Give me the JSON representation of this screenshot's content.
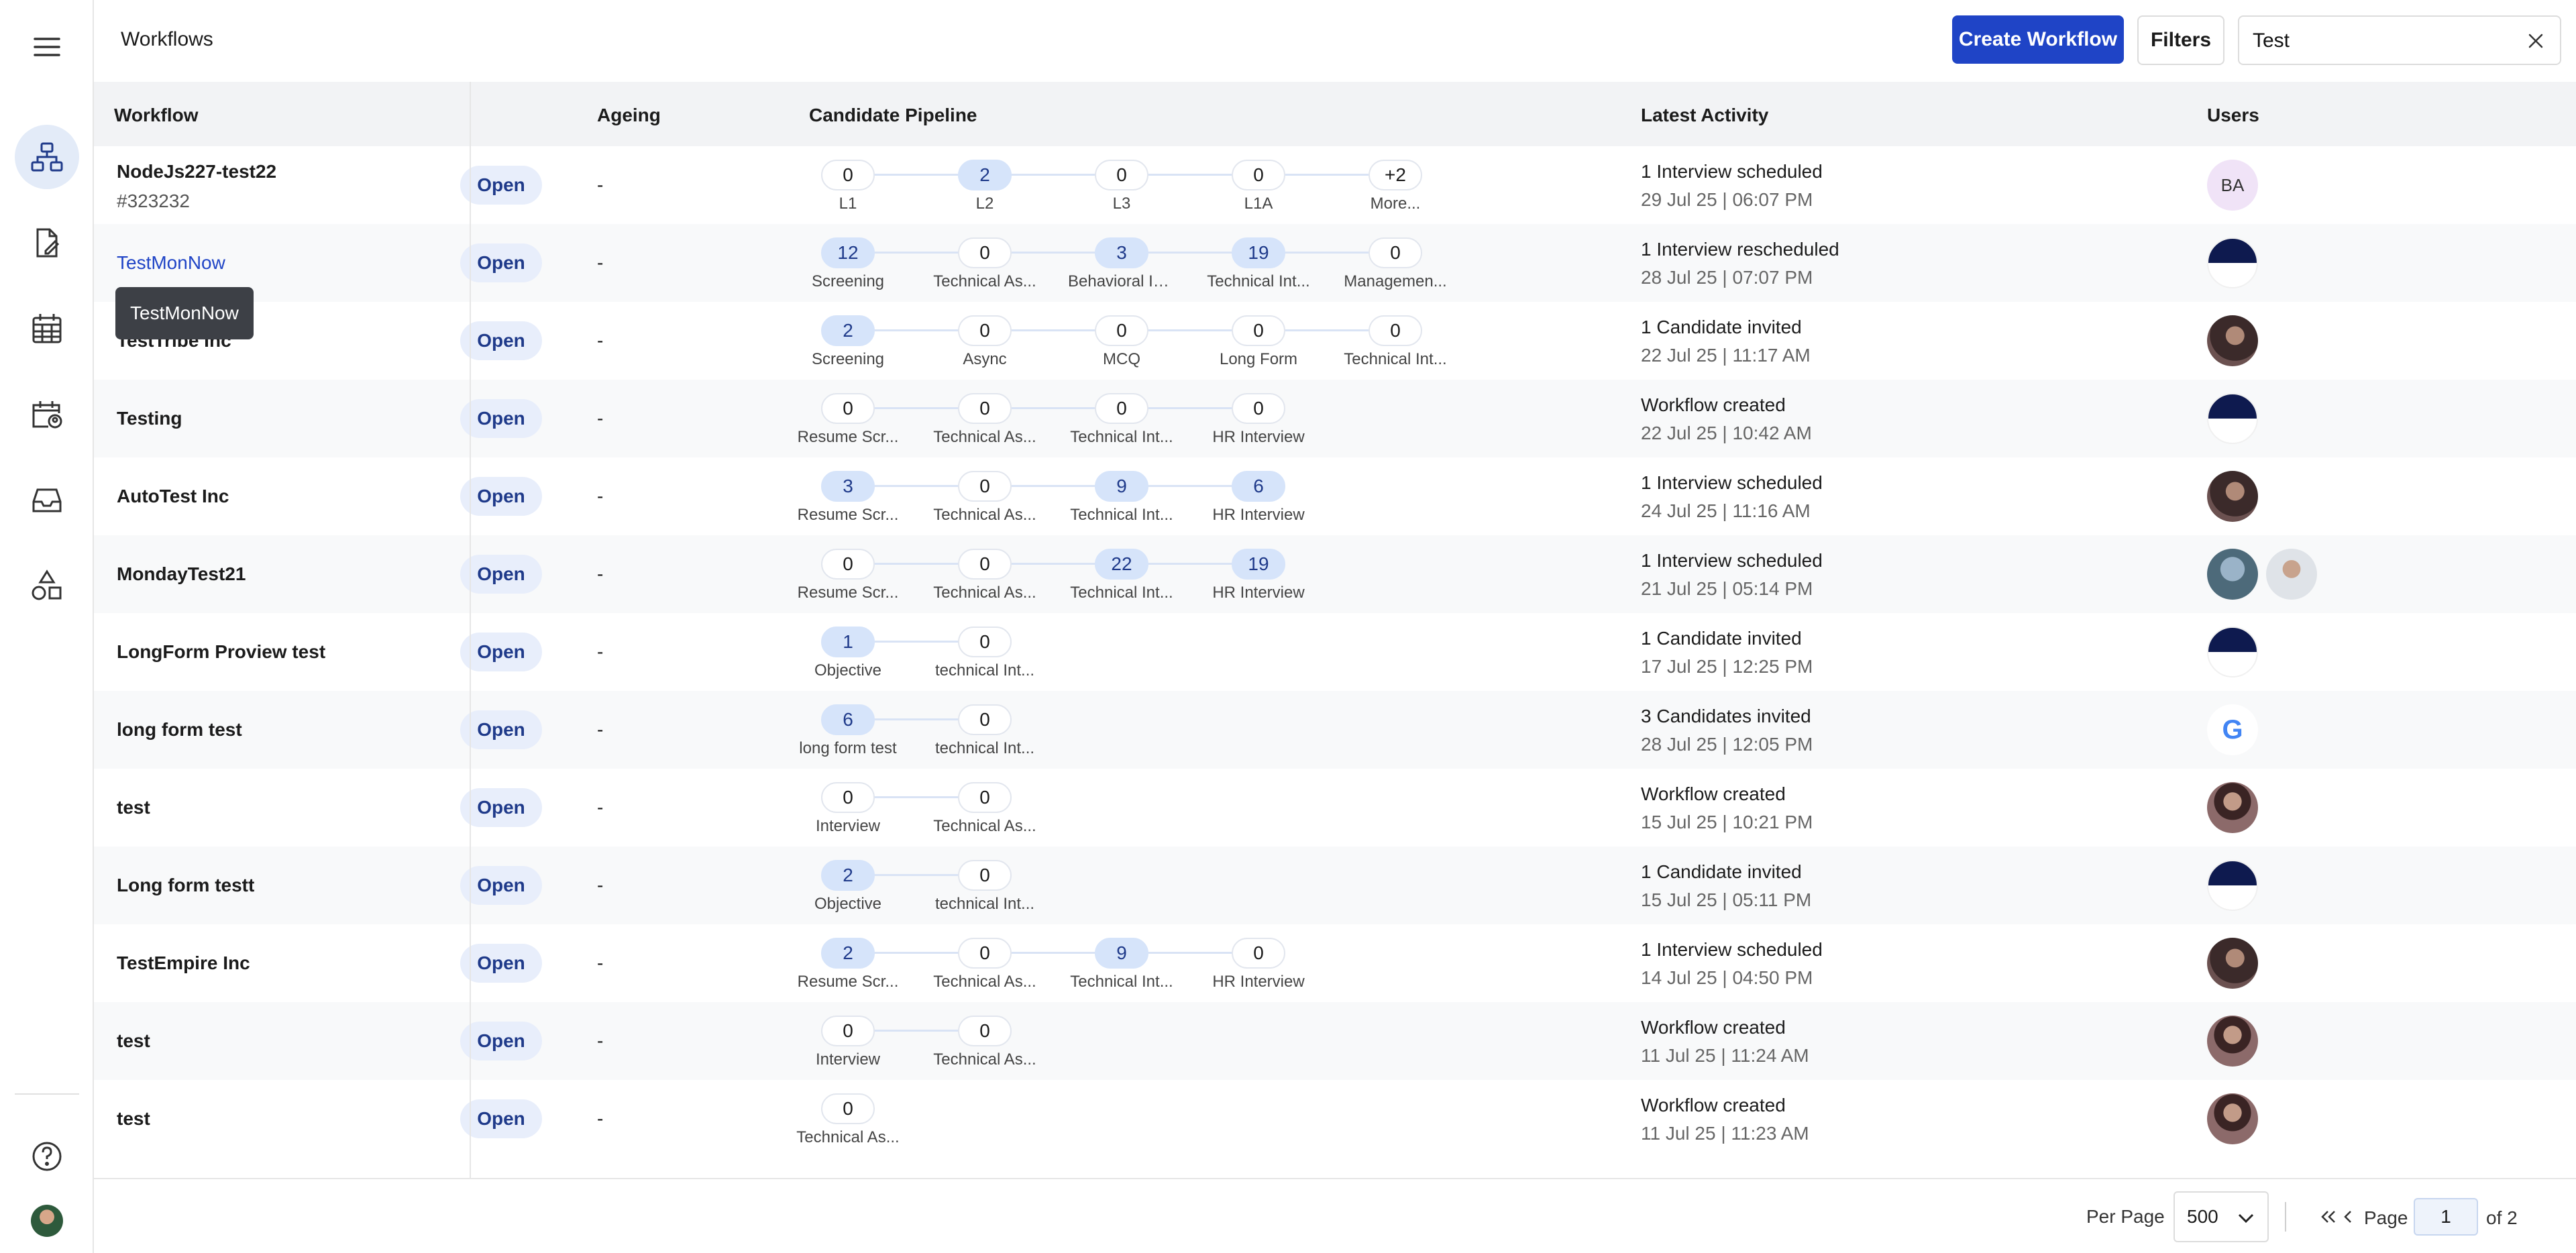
{
  "header": {
    "title": "Workflows",
    "create_label": "Create Workflow",
    "filters_label": "Filters",
    "search_value": "Test"
  },
  "columns": {
    "workflow": "Workflow",
    "ageing": "Ageing",
    "pipeline": "Candidate Pipeline",
    "activity": "Latest Activity",
    "users": "Users"
  },
  "tooltip": "TestMonNow",
  "colors": {
    "accent": "#1f44c6",
    "badge_bg": "#e8eefb",
    "stage_active": "#d6e4fa"
  },
  "rows": [
    {
      "name": "NodeJs227-test22",
      "id": "#323232",
      "status": "Open",
      "ageing": "-",
      "stages": [
        {
          "count": "0",
          "label": "L1"
        },
        {
          "count": "2",
          "label": "L2"
        },
        {
          "count": "0",
          "label": "L3"
        },
        {
          "count": "0",
          "label": "L1A"
        },
        {
          "count": "+2",
          "label": "More..."
        }
      ],
      "activity": "1 Interview scheduled",
      "time": "29 Jul 25 | 06:07 PM",
      "users": [
        "ba"
      ],
      "initials": "BA"
    },
    {
      "name": "TestMonNow",
      "status": "Open",
      "ageing": "-",
      "link": true,
      "stages": [
        {
          "count": "12",
          "label": "Screening"
        },
        {
          "count": "0",
          "label": "Technical As..."
        },
        {
          "count": "3",
          "label": "Behavioral In..."
        },
        {
          "count": "19",
          "label": "Technical Int..."
        },
        {
          "count": "0",
          "label": "Managemen..."
        }
      ],
      "activity": "1 Interview rescheduled",
      "time": "28 Jul 25 | 07:07 PM",
      "users": [
        "half"
      ]
    },
    {
      "name": "TestTribe Inc",
      "status": "Open",
      "ageing": "-",
      "stages": [
        {
          "count": "2",
          "label": "Screening"
        },
        {
          "count": "0",
          "label": "Async"
        },
        {
          "count": "0",
          "label": "MCQ"
        },
        {
          "count": "0",
          "label": "Long Form"
        },
        {
          "count": "0",
          "label": "Technical Int..."
        }
      ],
      "activity": "1 Candidate invited",
      "time": "22 Jul 25 | 11:17 AM",
      "users": [
        "photo"
      ]
    },
    {
      "name": "Testing",
      "status": "Open",
      "ageing": "-",
      "stages": [
        {
          "count": "0",
          "label": "Resume Scr..."
        },
        {
          "count": "0",
          "label": "Technical As..."
        },
        {
          "count": "0",
          "label": "Technical Int..."
        },
        {
          "count": "0",
          "label": "HR Interview"
        }
      ],
      "activity": "Workflow created",
      "time": "22 Jul 25 | 10:42 AM",
      "users": [
        "half"
      ]
    },
    {
      "name": "AutoTest Inc",
      "status": "Open",
      "ageing": "-",
      "stages": [
        {
          "count": "3",
          "label": "Resume Scr..."
        },
        {
          "count": "0",
          "label": "Technical As..."
        },
        {
          "count": "9",
          "label": "Technical Int..."
        },
        {
          "count": "6",
          "label": "HR Interview"
        }
      ],
      "activity": "1 Interview scheduled",
      "time": "24 Jul 25 | 11:16 AM",
      "users": [
        "photo"
      ]
    },
    {
      "name": "MondayTest21",
      "status": "Open",
      "ageing": "-",
      "stages": [
        {
          "count": "0",
          "label": "Resume Scr..."
        },
        {
          "count": "0",
          "label": "Technical As..."
        },
        {
          "count": "22",
          "label": "Technical Int..."
        },
        {
          "count": "19",
          "label": "HR Interview"
        }
      ],
      "activity": "1 Interview scheduled",
      "time": "21 Jul 25 | 05:14 PM",
      "users": [
        "photo3",
        "photo2"
      ]
    },
    {
      "name": "LongForm Proview test",
      "status": "Open",
      "ageing": "-",
      "stages": [
        {
          "count": "1",
          "label": "Objective"
        },
        {
          "count": "0",
          "label": "technical Int..."
        }
      ],
      "activity": "1 Candidate invited",
      "time": "17 Jul 25 | 12:25 PM",
      "users": [
        "half"
      ]
    },
    {
      "name": "long form test",
      "status": "Open",
      "ageing": "-",
      "stages": [
        {
          "count": "6",
          "label": "long form test"
        },
        {
          "count": "0",
          "label": "technical Int..."
        }
      ],
      "activity": "3 Candidates invited",
      "time": "28 Jul 25 | 12:05 PM",
      "users": [
        "google"
      ]
    },
    {
      "name": "test",
      "status": "Open",
      "ageing": "-",
      "stages": [
        {
          "count": "0",
          "label": "Interview"
        },
        {
          "count": "0",
          "label": "Technical As..."
        }
      ],
      "activity": "Workflow created",
      "time": "15 Jul 25 | 10:21 PM",
      "users": [
        "checker"
      ]
    },
    {
      "name": "Long form testt",
      "status": "Open",
      "ageing": "-",
      "stages": [
        {
          "count": "2",
          "label": "Objective"
        },
        {
          "count": "0",
          "label": "technical Int..."
        }
      ],
      "activity": "1 Candidate invited",
      "time": "15 Jul 25 | 05:11 PM",
      "users": [
        "half"
      ]
    },
    {
      "name": "TestEmpire Inc",
      "status": "Open",
      "ageing": "-",
      "stages": [
        {
          "count": "2",
          "label": "Resume Scr..."
        },
        {
          "count": "0",
          "label": "Technical As..."
        },
        {
          "count": "9",
          "label": "Technical Int..."
        },
        {
          "count": "0",
          "label": "HR Interview"
        }
      ],
      "activity": "1 Interview scheduled",
      "time": "14 Jul 25 | 04:50 PM",
      "users": [
        "photo"
      ]
    },
    {
      "name": "test",
      "status": "Open",
      "ageing": "-",
      "stages": [
        {
          "count": "0",
          "label": "Interview"
        },
        {
          "count": "0",
          "label": "Technical As..."
        }
      ],
      "activity": "Workflow created",
      "time": "11 Jul 25 | 11:24 AM",
      "users": [
        "checker"
      ]
    },
    {
      "name": "test",
      "status": "Open",
      "ageing": "-",
      "stages": [
        {
          "count": "0",
          "label": "Technical As..."
        }
      ],
      "activity": "Workflow created",
      "time": "11 Jul 25 | 11:23 AM",
      "users": [
        "checker"
      ]
    }
  ],
  "footer": {
    "per_page_label": "Per Page",
    "per_page_value": "500",
    "page_label": "Page",
    "page_value": "1",
    "page_of": "of 2"
  }
}
